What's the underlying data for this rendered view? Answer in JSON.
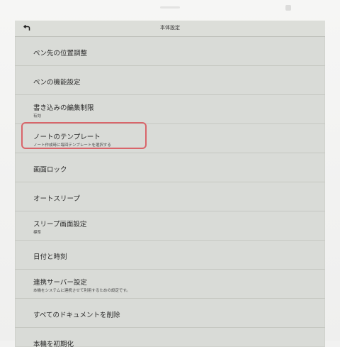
{
  "header": {
    "title": "本体設定",
    "back_icon": "back-arrow-icon"
  },
  "items": [
    {
      "label": "ペン先の位置調整",
      "sub": ""
    },
    {
      "label": "ペンの機能設定",
      "sub": ""
    },
    {
      "label": "書き込みの編集制限",
      "sub": "有効"
    },
    {
      "label": "ノートのテンプレート",
      "sub": "ノート作成時に毎回テンプレートを選択する"
    },
    {
      "label": "画面ロック",
      "sub": ""
    },
    {
      "label": "オートスリープ",
      "sub": ""
    },
    {
      "label": "スリープ画面設定",
      "sub": "標準"
    },
    {
      "label": "日付と時刻",
      "sub": ""
    },
    {
      "label": "連携サーバー設定",
      "sub": "本機をシステムに連携させて利用するための設定です。"
    },
    {
      "label": "すべてのドキュメントを削除",
      "sub": ""
    },
    {
      "label": "本機を初期化",
      "sub": ""
    }
  ],
  "colors": {
    "highlight": "#d9656a",
    "screen": "#d9dbd7"
  }
}
